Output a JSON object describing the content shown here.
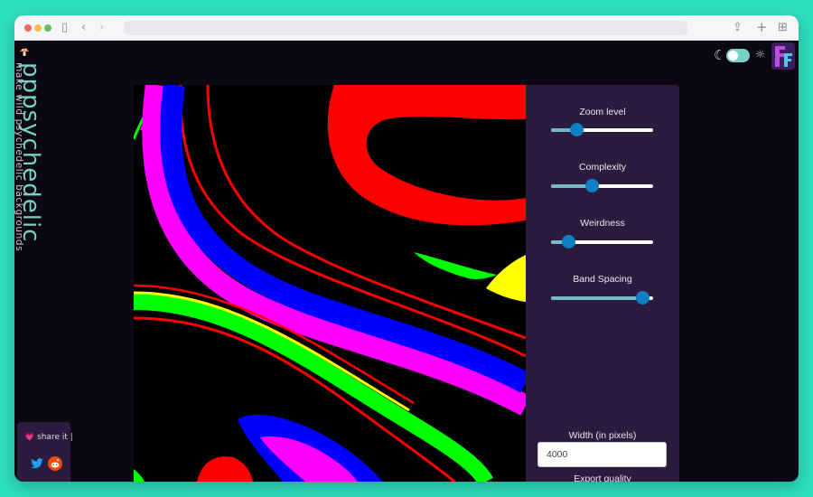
{
  "brand": {
    "title": "pppsychedelic",
    "tagline": "make wild psychedelic backgrounds"
  },
  "theme": {
    "moon_icon": "☾",
    "sun_icon": "☼"
  },
  "controls": [
    {
      "label": "Zoom level",
      "value": 0.25
    },
    {
      "label": "Complexity",
      "value": 0.4
    },
    {
      "label": "Weirdness",
      "value": 0.17
    },
    {
      "label": "Band Spacing",
      "value": 0.9
    }
  ],
  "export": {
    "width_label": "Width (in pixels)",
    "width_value": "4000",
    "quality_label": "Export quality"
  },
  "share": {
    "label": "💗 share it |"
  },
  "colors": {
    "accent": "#76d1c6",
    "panel": "#2b1c3f",
    "slider_thumb": "#0d7fc2",
    "background": "#0c0812"
  }
}
